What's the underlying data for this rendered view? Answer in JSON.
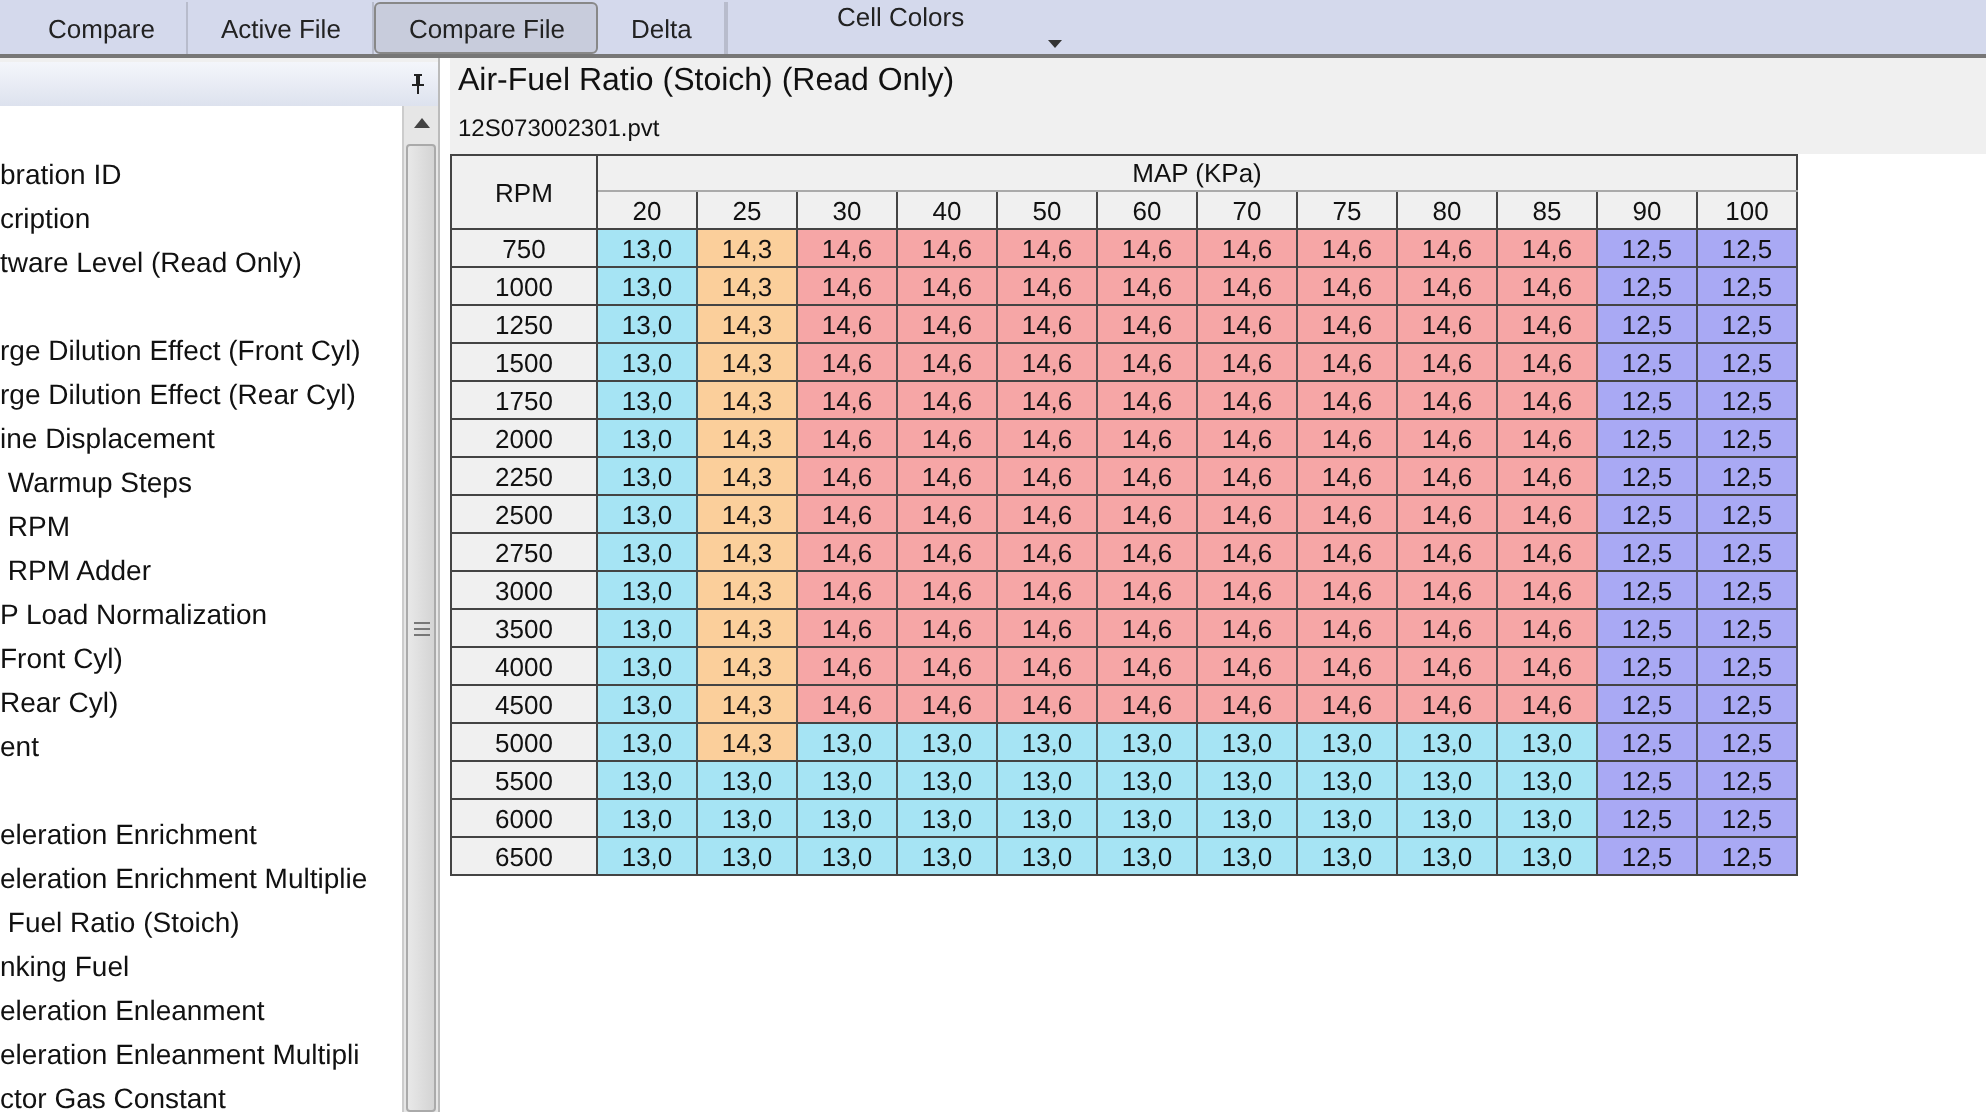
{
  "toolbar": {
    "buttons": [
      {
        "label": "Compare",
        "selected": false
      },
      {
        "label": "Active File",
        "selected": false
      },
      {
        "label": "Compare File",
        "selected": true
      },
      {
        "label": "Delta",
        "selected": false
      }
    ],
    "dropdown": {
      "label": "Cell Colors"
    }
  },
  "sidebar": {
    "groups": [
      [
        "bration ID",
        "cription",
        "tware Level (Read Only)"
      ],
      [
        "rge Dilution Effect (Front Cyl)",
        "rge Dilution Effect (Rear Cyl)",
        "ine Displacement",
        " Warmup Steps",
        " RPM",
        " RPM Adder",
        "P Load Normalization",
        "Front Cyl)",
        "Rear Cyl)",
        "ent"
      ],
      [
        "eleration Enrichment",
        "eleration Enrichment Multiplie",
        " Fuel Ratio (Stoich)",
        "nking Fuel",
        "eleration Enleanment",
        "eleration Enleanment Multipli",
        "ctor Gas Constant"
      ]
    ]
  },
  "panel": {
    "title": "Air-Fuel Ratio (Stoich) (Read Only)",
    "file": "12S073002301.pvt"
  },
  "table": {
    "row_header": "RPM",
    "column_group": "MAP (KPa)",
    "columns": [
      "20",
      "25",
      "30",
      "40",
      "50",
      "60",
      "70",
      "75",
      "80",
      "85",
      "90",
      "100"
    ],
    "rows": [
      {
        "rpm": "750",
        "cells": [
          {
            "value": "13,0",
            "color": "#a6e4f4"
          },
          {
            "value": "14,3",
            "color": "#fbcf9b"
          },
          {
            "value": "14,6",
            "color": "#f6a6a6"
          },
          {
            "value": "14,6",
            "color": "#f6a6a6"
          },
          {
            "value": "14,6",
            "color": "#f6a6a6"
          },
          {
            "value": "14,6",
            "color": "#f6a6a6"
          },
          {
            "value": "14,6",
            "color": "#f6a6a6"
          },
          {
            "value": "14,6",
            "color": "#f6a6a6"
          },
          {
            "value": "14,6",
            "color": "#f6a6a6"
          },
          {
            "value": "14,6",
            "color": "#f6a6a6"
          },
          {
            "value": "12,5",
            "color": "#a9a9f4"
          },
          {
            "value": "12,5",
            "color": "#a9a9f4"
          }
        ]
      },
      {
        "rpm": "1000",
        "cells": [
          {
            "value": "13,0",
            "color": "#a6e4f4"
          },
          {
            "value": "14,3",
            "color": "#fbcf9b"
          },
          {
            "value": "14,6",
            "color": "#f6a6a6"
          },
          {
            "value": "14,6",
            "color": "#f6a6a6"
          },
          {
            "value": "14,6",
            "color": "#f6a6a6"
          },
          {
            "value": "14,6",
            "color": "#f6a6a6"
          },
          {
            "value": "14,6",
            "color": "#f6a6a6"
          },
          {
            "value": "14,6",
            "color": "#f6a6a6"
          },
          {
            "value": "14,6",
            "color": "#f6a6a6"
          },
          {
            "value": "14,6",
            "color": "#f6a6a6"
          },
          {
            "value": "12,5",
            "color": "#a9a9f4"
          },
          {
            "value": "12,5",
            "color": "#a9a9f4"
          }
        ]
      },
      {
        "rpm": "1250",
        "cells": [
          {
            "value": "13,0",
            "color": "#a6e4f4"
          },
          {
            "value": "14,3",
            "color": "#fbcf9b"
          },
          {
            "value": "14,6",
            "color": "#f6a6a6"
          },
          {
            "value": "14,6",
            "color": "#f6a6a6"
          },
          {
            "value": "14,6",
            "color": "#f6a6a6"
          },
          {
            "value": "14,6",
            "color": "#f6a6a6"
          },
          {
            "value": "14,6",
            "color": "#f6a6a6"
          },
          {
            "value": "14,6",
            "color": "#f6a6a6"
          },
          {
            "value": "14,6",
            "color": "#f6a6a6"
          },
          {
            "value": "14,6",
            "color": "#f6a6a6"
          },
          {
            "value": "12,5",
            "color": "#a9a9f4"
          },
          {
            "value": "12,5",
            "color": "#a9a9f4"
          }
        ]
      },
      {
        "rpm": "1500",
        "cells": [
          {
            "value": "13,0",
            "color": "#a6e4f4"
          },
          {
            "value": "14,3",
            "color": "#fbcf9b"
          },
          {
            "value": "14,6",
            "color": "#f6a6a6"
          },
          {
            "value": "14,6",
            "color": "#f6a6a6"
          },
          {
            "value": "14,6",
            "color": "#f6a6a6"
          },
          {
            "value": "14,6",
            "color": "#f6a6a6"
          },
          {
            "value": "14,6",
            "color": "#f6a6a6"
          },
          {
            "value": "14,6",
            "color": "#f6a6a6"
          },
          {
            "value": "14,6",
            "color": "#f6a6a6"
          },
          {
            "value": "14,6",
            "color": "#f6a6a6"
          },
          {
            "value": "12,5",
            "color": "#a9a9f4"
          },
          {
            "value": "12,5",
            "color": "#a9a9f4"
          }
        ]
      },
      {
        "rpm": "1750",
        "cells": [
          {
            "value": "13,0",
            "color": "#a6e4f4"
          },
          {
            "value": "14,3",
            "color": "#fbcf9b"
          },
          {
            "value": "14,6",
            "color": "#f6a6a6"
          },
          {
            "value": "14,6",
            "color": "#f6a6a6"
          },
          {
            "value": "14,6",
            "color": "#f6a6a6"
          },
          {
            "value": "14,6",
            "color": "#f6a6a6"
          },
          {
            "value": "14,6",
            "color": "#f6a6a6"
          },
          {
            "value": "14,6",
            "color": "#f6a6a6"
          },
          {
            "value": "14,6",
            "color": "#f6a6a6"
          },
          {
            "value": "14,6",
            "color": "#f6a6a6"
          },
          {
            "value": "12,5",
            "color": "#a9a9f4"
          },
          {
            "value": "12,5",
            "color": "#a9a9f4"
          }
        ]
      },
      {
        "rpm": "2000",
        "cells": [
          {
            "value": "13,0",
            "color": "#a6e4f4"
          },
          {
            "value": "14,3",
            "color": "#fbcf9b"
          },
          {
            "value": "14,6",
            "color": "#f6a6a6"
          },
          {
            "value": "14,6",
            "color": "#f6a6a6"
          },
          {
            "value": "14,6",
            "color": "#f6a6a6"
          },
          {
            "value": "14,6",
            "color": "#f6a6a6"
          },
          {
            "value": "14,6",
            "color": "#f6a6a6"
          },
          {
            "value": "14,6",
            "color": "#f6a6a6"
          },
          {
            "value": "14,6",
            "color": "#f6a6a6"
          },
          {
            "value": "14,6",
            "color": "#f6a6a6"
          },
          {
            "value": "12,5",
            "color": "#a9a9f4"
          },
          {
            "value": "12,5",
            "color": "#a9a9f4"
          }
        ]
      },
      {
        "rpm": "2250",
        "cells": [
          {
            "value": "13,0",
            "color": "#a6e4f4"
          },
          {
            "value": "14,3",
            "color": "#fbcf9b"
          },
          {
            "value": "14,6",
            "color": "#f6a6a6"
          },
          {
            "value": "14,6",
            "color": "#f6a6a6"
          },
          {
            "value": "14,6",
            "color": "#f6a6a6"
          },
          {
            "value": "14,6",
            "color": "#f6a6a6"
          },
          {
            "value": "14,6",
            "color": "#f6a6a6"
          },
          {
            "value": "14,6",
            "color": "#f6a6a6"
          },
          {
            "value": "14,6",
            "color": "#f6a6a6"
          },
          {
            "value": "14,6",
            "color": "#f6a6a6"
          },
          {
            "value": "12,5",
            "color": "#a9a9f4"
          },
          {
            "value": "12,5",
            "color": "#a9a9f4"
          }
        ]
      },
      {
        "rpm": "2500",
        "cells": [
          {
            "value": "13,0",
            "color": "#a6e4f4"
          },
          {
            "value": "14,3",
            "color": "#fbcf9b"
          },
          {
            "value": "14,6",
            "color": "#f6a6a6"
          },
          {
            "value": "14,6",
            "color": "#f6a6a6"
          },
          {
            "value": "14,6",
            "color": "#f6a6a6"
          },
          {
            "value": "14,6",
            "color": "#f6a6a6"
          },
          {
            "value": "14,6",
            "color": "#f6a6a6"
          },
          {
            "value": "14,6",
            "color": "#f6a6a6"
          },
          {
            "value": "14,6",
            "color": "#f6a6a6"
          },
          {
            "value": "14,6",
            "color": "#f6a6a6"
          },
          {
            "value": "12,5",
            "color": "#a9a9f4"
          },
          {
            "value": "12,5",
            "color": "#a9a9f4"
          }
        ]
      },
      {
        "rpm": "2750",
        "cells": [
          {
            "value": "13,0",
            "color": "#a6e4f4"
          },
          {
            "value": "14,3",
            "color": "#fbcf9b"
          },
          {
            "value": "14,6",
            "color": "#f6a6a6"
          },
          {
            "value": "14,6",
            "color": "#f6a6a6"
          },
          {
            "value": "14,6",
            "color": "#f6a6a6"
          },
          {
            "value": "14,6",
            "color": "#f6a6a6"
          },
          {
            "value": "14,6",
            "color": "#f6a6a6"
          },
          {
            "value": "14,6",
            "color": "#f6a6a6"
          },
          {
            "value": "14,6",
            "color": "#f6a6a6"
          },
          {
            "value": "14,6",
            "color": "#f6a6a6"
          },
          {
            "value": "12,5",
            "color": "#a9a9f4"
          },
          {
            "value": "12,5",
            "color": "#a9a9f4"
          }
        ]
      },
      {
        "rpm": "3000",
        "cells": [
          {
            "value": "13,0",
            "color": "#a6e4f4"
          },
          {
            "value": "14,3",
            "color": "#fbcf9b"
          },
          {
            "value": "14,6",
            "color": "#f6a6a6"
          },
          {
            "value": "14,6",
            "color": "#f6a6a6"
          },
          {
            "value": "14,6",
            "color": "#f6a6a6"
          },
          {
            "value": "14,6",
            "color": "#f6a6a6"
          },
          {
            "value": "14,6",
            "color": "#f6a6a6"
          },
          {
            "value": "14,6",
            "color": "#f6a6a6"
          },
          {
            "value": "14,6",
            "color": "#f6a6a6"
          },
          {
            "value": "14,6",
            "color": "#f6a6a6"
          },
          {
            "value": "12,5",
            "color": "#a9a9f4"
          },
          {
            "value": "12,5",
            "color": "#a9a9f4"
          }
        ]
      },
      {
        "rpm": "3500",
        "cells": [
          {
            "value": "13,0",
            "color": "#a6e4f4"
          },
          {
            "value": "14,3",
            "color": "#fbcf9b"
          },
          {
            "value": "14,6",
            "color": "#f6a6a6"
          },
          {
            "value": "14,6",
            "color": "#f6a6a6"
          },
          {
            "value": "14,6",
            "color": "#f6a6a6"
          },
          {
            "value": "14,6",
            "color": "#f6a6a6"
          },
          {
            "value": "14,6",
            "color": "#f6a6a6"
          },
          {
            "value": "14,6",
            "color": "#f6a6a6"
          },
          {
            "value": "14,6",
            "color": "#f6a6a6"
          },
          {
            "value": "14,6",
            "color": "#f6a6a6"
          },
          {
            "value": "12,5",
            "color": "#a9a9f4"
          },
          {
            "value": "12,5",
            "color": "#a9a9f4"
          }
        ]
      },
      {
        "rpm": "4000",
        "cells": [
          {
            "value": "13,0",
            "color": "#a6e4f4"
          },
          {
            "value": "14,3",
            "color": "#fbcf9b"
          },
          {
            "value": "14,6",
            "color": "#f6a6a6"
          },
          {
            "value": "14,6",
            "color": "#f6a6a6"
          },
          {
            "value": "14,6",
            "color": "#f6a6a6"
          },
          {
            "value": "14,6",
            "color": "#f6a6a6"
          },
          {
            "value": "14,6",
            "color": "#f6a6a6"
          },
          {
            "value": "14,6",
            "color": "#f6a6a6"
          },
          {
            "value": "14,6",
            "color": "#f6a6a6"
          },
          {
            "value": "14,6",
            "color": "#f6a6a6"
          },
          {
            "value": "12,5",
            "color": "#a9a9f4"
          },
          {
            "value": "12,5",
            "color": "#a9a9f4"
          }
        ]
      },
      {
        "rpm": "4500",
        "cells": [
          {
            "value": "13,0",
            "color": "#a6e4f4"
          },
          {
            "value": "14,3",
            "color": "#fbcf9b"
          },
          {
            "value": "14,6",
            "color": "#f6a6a6"
          },
          {
            "value": "14,6",
            "color": "#f6a6a6"
          },
          {
            "value": "14,6",
            "color": "#f6a6a6"
          },
          {
            "value": "14,6",
            "color": "#f6a6a6"
          },
          {
            "value": "14,6",
            "color": "#f6a6a6"
          },
          {
            "value": "14,6",
            "color": "#f6a6a6"
          },
          {
            "value": "14,6",
            "color": "#f6a6a6"
          },
          {
            "value": "14,6",
            "color": "#f6a6a6"
          },
          {
            "value": "12,5",
            "color": "#a9a9f4"
          },
          {
            "value": "12,5",
            "color": "#a9a9f4"
          }
        ]
      },
      {
        "rpm": "5000",
        "cells": [
          {
            "value": "13,0",
            "color": "#a6e4f4"
          },
          {
            "value": "14,3",
            "color": "#fbcf9b"
          },
          {
            "value": "13,0",
            "color": "#a6e4f4"
          },
          {
            "value": "13,0",
            "color": "#a6e4f4"
          },
          {
            "value": "13,0",
            "color": "#a6e4f4"
          },
          {
            "value": "13,0",
            "color": "#a6e4f4"
          },
          {
            "value": "13,0",
            "color": "#a6e4f4"
          },
          {
            "value": "13,0",
            "color": "#a6e4f4"
          },
          {
            "value": "13,0",
            "color": "#a6e4f4"
          },
          {
            "value": "13,0",
            "color": "#a6e4f4"
          },
          {
            "value": "12,5",
            "color": "#a9a9f4"
          },
          {
            "value": "12,5",
            "color": "#a9a9f4"
          }
        ]
      },
      {
        "rpm": "5500",
        "cells": [
          {
            "value": "13,0",
            "color": "#a6e4f4"
          },
          {
            "value": "13,0",
            "color": "#a6e4f4"
          },
          {
            "value": "13,0",
            "color": "#a6e4f4"
          },
          {
            "value": "13,0",
            "color": "#a6e4f4"
          },
          {
            "value": "13,0",
            "color": "#a6e4f4"
          },
          {
            "value": "13,0",
            "color": "#a6e4f4"
          },
          {
            "value": "13,0",
            "color": "#a6e4f4"
          },
          {
            "value": "13,0",
            "color": "#a6e4f4"
          },
          {
            "value": "13,0",
            "color": "#a6e4f4"
          },
          {
            "value": "13,0",
            "color": "#a6e4f4"
          },
          {
            "value": "12,5",
            "color": "#a9a9f4"
          },
          {
            "value": "12,5",
            "color": "#a9a9f4"
          }
        ]
      },
      {
        "rpm": "6000",
        "cells": [
          {
            "value": "13,0",
            "color": "#a6e4f4"
          },
          {
            "value": "13,0",
            "color": "#a6e4f4"
          },
          {
            "value": "13,0",
            "color": "#a6e4f4"
          },
          {
            "value": "13,0",
            "color": "#a6e4f4"
          },
          {
            "value": "13,0",
            "color": "#a6e4f4"
          },
          {
            "value": "13,0",
            "color": "#a6e4f4"
          },
          {
            "value": "13,0",
            "color": "#a6e4f4"
          },
          {
            "value": "13,0",
            "color": "#a6e4f4"
          },
          {
            "value": "13,0",
            "color": "#a6e4f4"
          },
          {
            "value": "13,0",
            "color": "#a6e4f4"
          },
          {
            "value": "12,5",
            "color": "#a9a9f4"
          },
          {
            "value": "12,5",
            "color": "#a9a9f4"
          }
        ]
      },
      {
        "rpm": "6500",
        "cells": [
          {
            "value": "13,0",
            "color": "#a6e4f4"
          },
          {
            "value": "13,0",
            "color": "#a6e4f4"
          },
          {
            "value": "13,0",
            "color": "#a6e4f4"
          },
          {
            "value": "13,0",
            "color": "#a6e4f4"
          },
          {
            "value": "13,0",
            "color": "#a6e4f4"
          },
          {
            "value": "13,0",
            "color": "#a6e4f4"
          },
          {
            "value": "13,0",
            "color": "#a6e4f4"
          },
          {
            "value": "13,0",
            "color": "#a6e4f4"
          },
          {
            "value": "13,0",
            "color": "#a6e4f4"
          },
          {
            "value": "13,0",
            "color": "#a6e4f4"
          },
          {
            "value": "12,5",
            "color": "#a9a9f4"
          },
          {
            "value": "12,5",
            "color": "#a9a9f4"
          }
        ]
      }
    ]
  }
}
